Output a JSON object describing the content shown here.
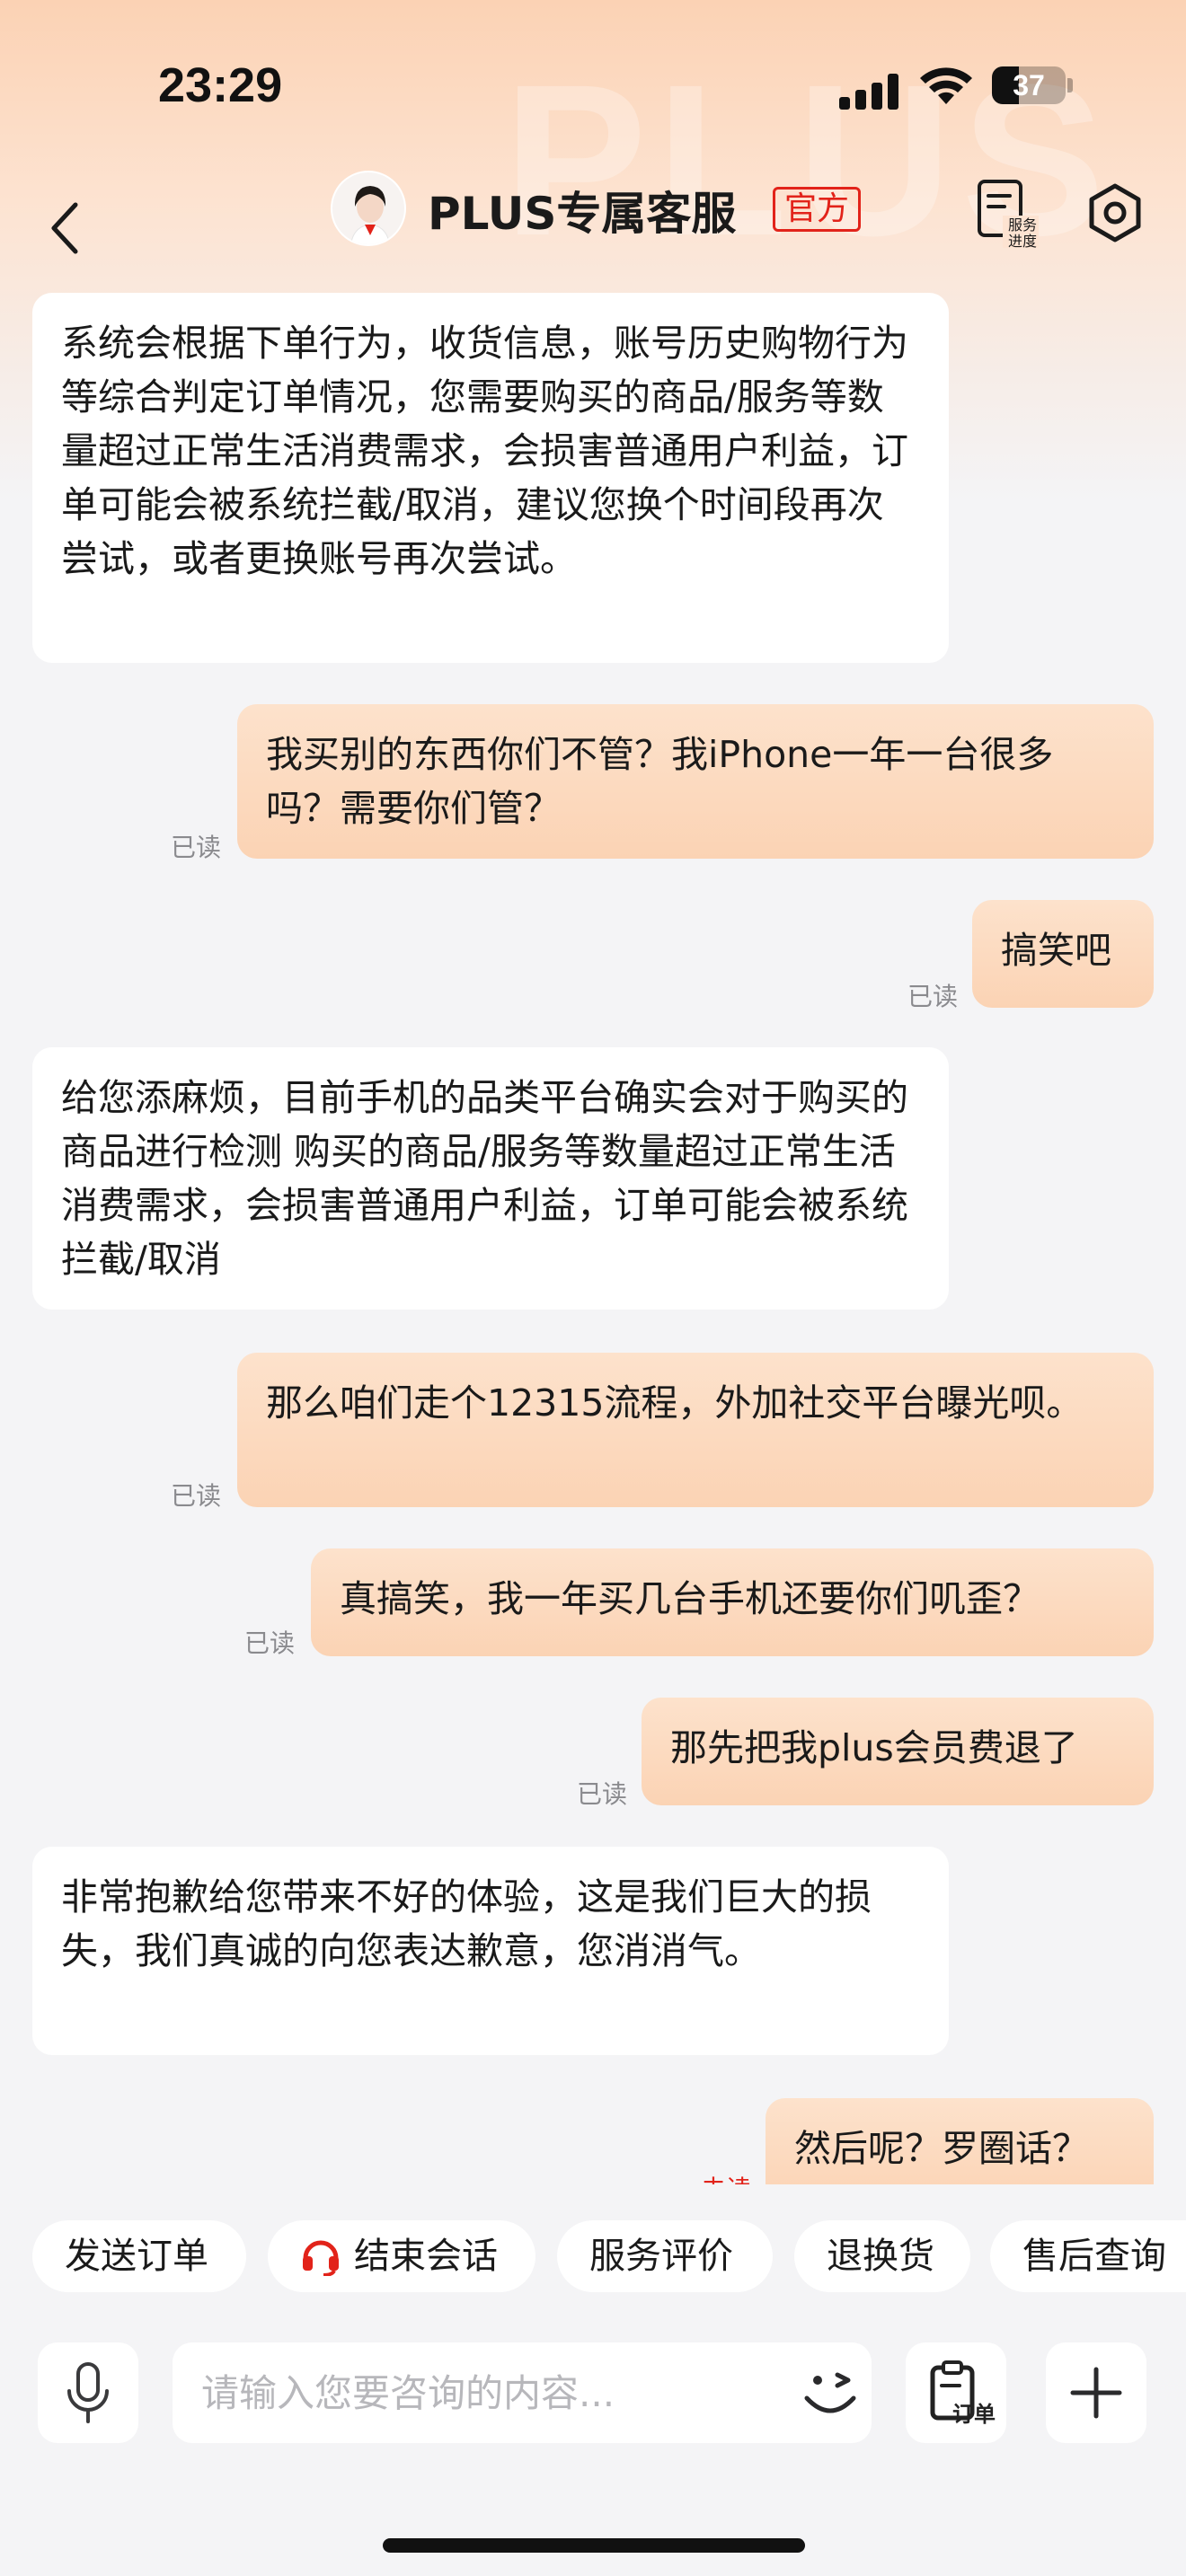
{
  "status_bar": {
    "time": "23:29",
    "battery": "37",
    "battery_level": 0.37
  },
  "header": {
    "title": "PLUS专属客服",
    "badge": "官方",
    "progress_label_line1": "服务",
    "progress_label_line2": "进度",
    "watermark": "PLUS"
  },
  "messages": [
    {
      "side": "left",
      "text": "系统会根据下单行为，收货信息，账号历史购物行为等综合判定订单情况，您需要购买的商品/服务等数量超过正常生活消费需求，会损害普通用户利益，订单可能会被系统拦截/取消，建议您换个时间段再次尝试，或者更换账号再次尝试。"
    },
    {
      "side": "right",
      "text": "我买别的东西你们不管？我iPhone一年一台很多吗？需要你们管？",
      "status": "已读"
    },
    {
      "side": "right",
      "text": "搞笑吧",
      "status": "已读"
    },
    {
      "side": "left",
      "text": "给您添麻烦，目前手机的品类平台确实会对于购买的商品进行检测 购买的商品/服务等数量超过正常生活消费需求，会损害普通用户利益，订单可能会被系统拦截/取消"
    },
    {
      "side": "right",
      "text": "那么咱们走个12315流程，外加社交平台曝光呗。",
      "status": "已读"
    },
    {
      "side": "right",
      "text": "真搞笑，我一年买几台手机还要你们叽歪？",
      "status": "已读"
    },
    {
      "side": "right",
      "text": "那先把我plus会员费退了",
      "status": "已读"
    },
    {
      "side": "left",
      "text": "非常抱歉给您带来不好的体验，这是我们巨大的损失，我们真诚的向您表达歉意，您消消气。"
    },
    {
      "side": "right",
      "text": "然后呢？罗圈话？",
      "status": "未读"
    }
  ],
  "quick_actions": [
    "发送订单",
    "结束会话",
    "服务评价",
    "退换货",
    "售后查询"
  ],
  "input": {
    "placeholder": "请输入您要咨询的内容...",
    "order_label": "订单"
  },
  "colors": {
    "accent_red": "#e2231a",
    "bubble_user": "#fbd3b4",
    "bubble_agent": "#ffffff"
  }
}
